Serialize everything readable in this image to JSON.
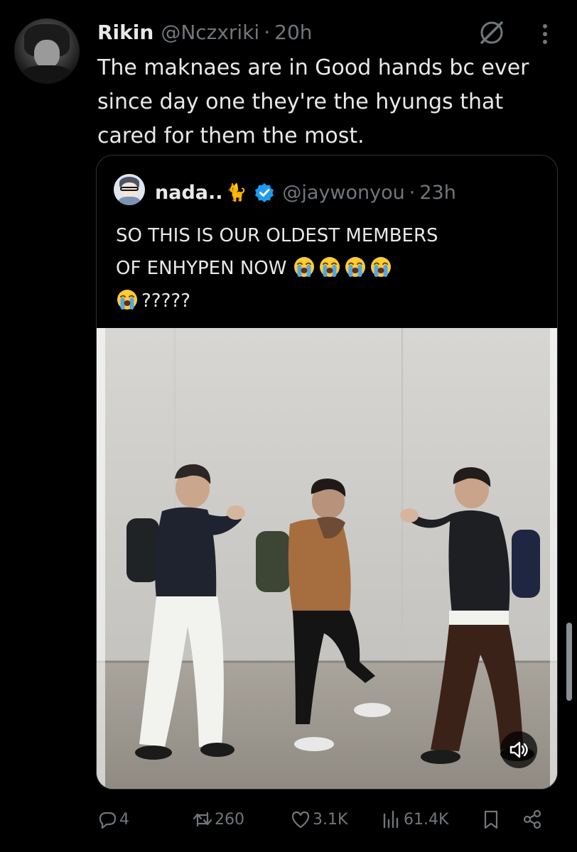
{
  "tweet": {
    "author_name": "Rikin",
    "author_handle": "@Nczxriki",
    "separator": "·",
    "time": "20h",
    "text": "The maknaes are in Good hands bc ever since day one they're the hyungs that cared for them the most."
  },
  "quoted": {
    "author_name": "nada..",
    "author_emoji": "🐈",
    "author_handle": "@jaywonyou",
    "separator": "·",
    "time": "23h",
    "text_line1": "SO THIS IS OUR OLDEST MEMBERS",
    "text_line2": "OF ENHYPEN NOW",
    "text_line3": "?????",
    "crying_emoji_count_line2": 4,
    "crying_emoji_count_line3": 1
  },
  "metrics": {
    "replies": "4",
    "reposts": "260",
    "likes": "3.1K",
    "views": "61.4K"
  },
  "icons": {
    "grok": "grok-icon",
    "more": "more-vertical-icon",
    "verified": "verified-badge-icon",
    "volume": "volume-icon",
    "reply": "reply-icon",
    "repost": "repost-icon",
    "like": "heart-icon",
    "views": "views-icon",
    "bookmark": "bookmark-icon",
    "share": "share-icon"
  },
  "colors": {
    "background": "#000000",
    "text": "#e7e9ea",
    "secondary": "#71767b",
    "border": "#2f3336",
    "verified": "#1d9bf0"
  }
}
